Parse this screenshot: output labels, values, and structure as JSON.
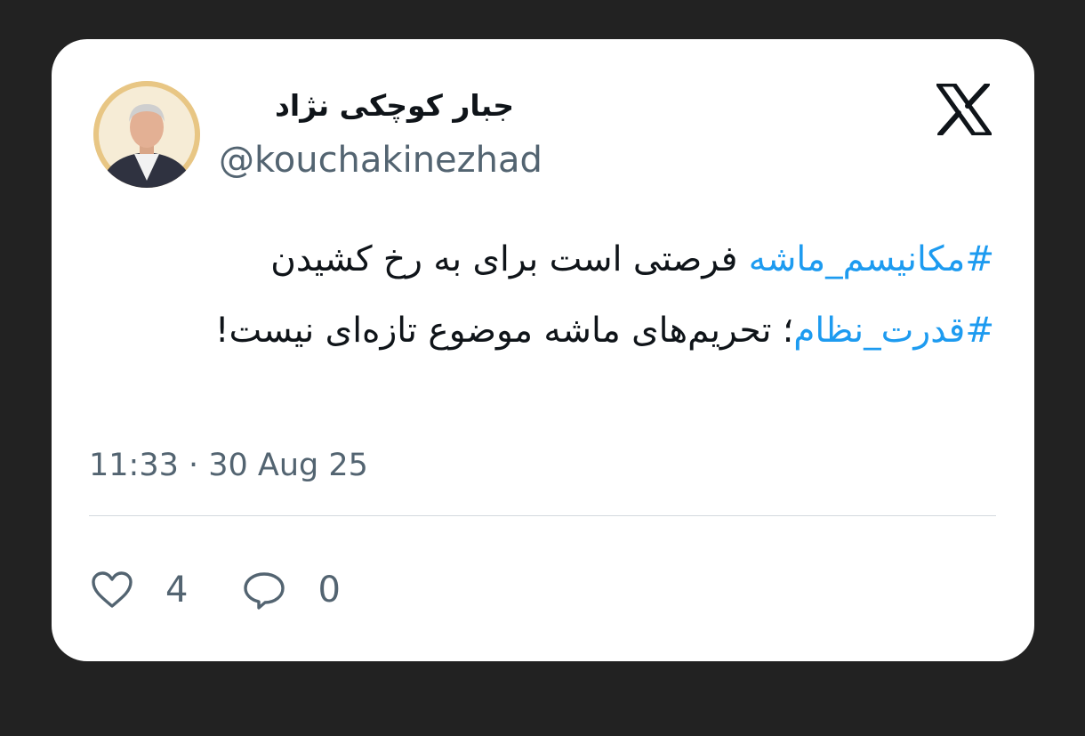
{
  "tweet": {
    "author": {
      "display_name": "جبار کوچکی نژاد",
      "handle": "@kouchakinezhad"
    },
    "text": {
      "hashtag_1": "#مکانیسم_ماشه",
      "segment_1": " فرصتی است برای به رخ کشیدن ",
      "hashtag_2": "#قدرت_نظام",
      "segment_2": "؛ تحریم‌های ماشه موضوع تازه‌ای نیست!"
    },
    "timestamp": "11:33 · 30 Aug 25",
    "likes_count": "4",
    "replies_count": "0"
  },
  "icons": {
    "platform_logo": "x-logo-icon",
    "like": "heart-outline-icon",
    "reply": "speech-bubble-icon"
  },
  "colors": {
    "background": "#222222",
    "card": "#ffffff",
    "text": "#0f1419",
    "secondary_text": "#536471",
    "hashtag": "#1d9bf0",
    "divider": "#d3d9de"
  }
}
